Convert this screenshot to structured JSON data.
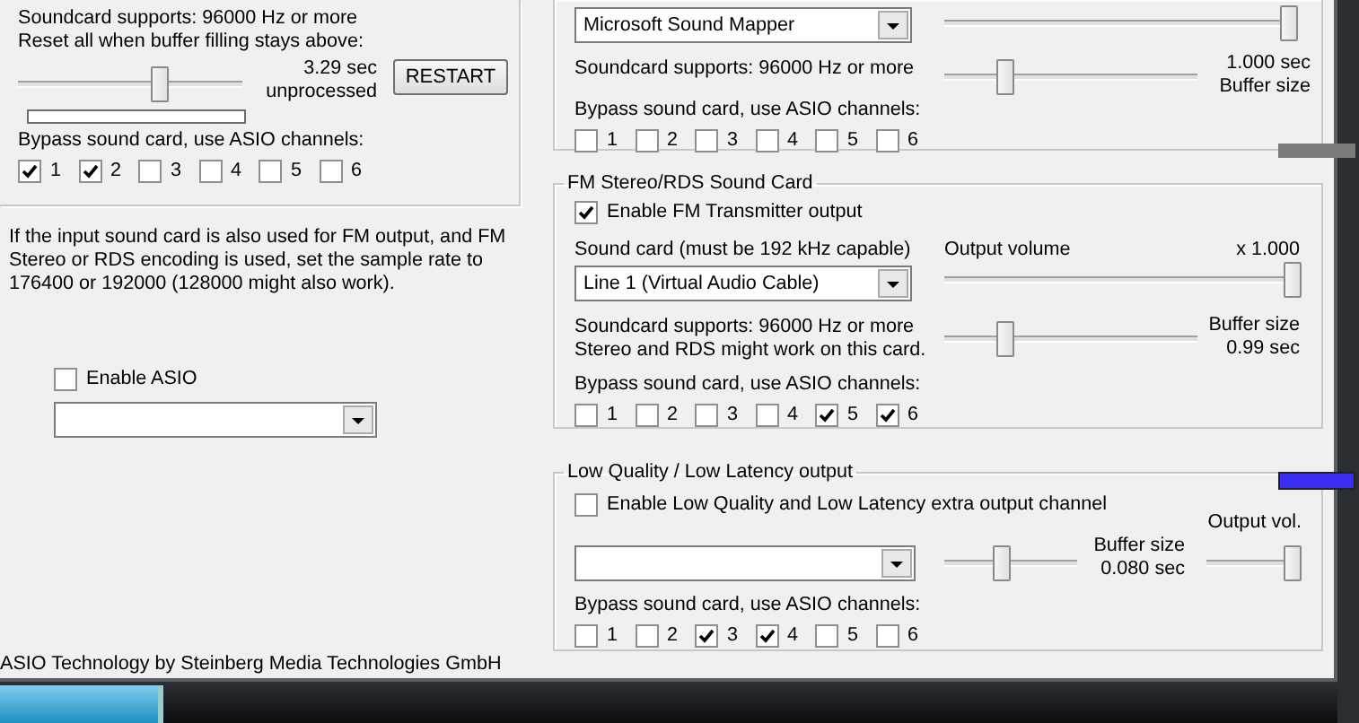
{
  "left_group": {
    "soundcard_supports": "Soundcard supports:  96000 Hz or more",
    "reset_label": "Reset all when buffer filling stays above:",
    "reset_slider": {
      "level": 0.64
    },
    "readout": [
      "3.29 sec",
      "unprocessed"
    ],
    "restart_button": "RESTART",
    "bypass_label": "Bypass sound card, use ASIO channels:",
    "channels": [
      {
        "label": "1",
        "checked": true
      },
      {
        "label": "2",
        "checked": true
      },
      {
        "label": "3",
        "checked": false
      },
      {
        "label": "4",
        "checked": false
      },
      {
        "label": "5",
        "checked": false
      },
      {
        "label": "6",
        "checked": false
      }
    ]
  },
  "sample_rate_note": "If the input sound card is also used for FM output, and FM Stereo or RDS encoding is used, set the sample rate to 176400 or 192000 (128000 might also work).",
  "asio": {
    "label": "Enable ASIO",
    "checked": false
  },
  "footer": "ASIO Technology by Steinberg Media Technologies GmbH",
  "output_group": {
    "sound_card": "Microsoft Sound Mapper",
    "volume_slider": {
      "level": 1
    },
    "soundcard_supports": "Soundcard supports:  96000 Hz or more",
    "buffer_slider": {
      "level": 0.22
    },
    "buffer_readout": [
      "1.000 sec",
      "Buffer size"
    ],
    "bypass_label": "Bypass sound card, use ASIO channels:",
    "channels": [
      {
        "label": "1",
        "checked": false
      },
      {
        "label": "2",
        "checked": false
      },
      {
        "label": "3",
        "checked": false
      },
      {
        "label": "4",
        "checked": false
      },
      {
        "label": "5",
        "checked": false
      },
      {
        "label": "6",
        "checked": false
      }
    ]
  },
  "fm_group": {
    "title": "FM Stereo/RDS Sound Card",
    "enable": {
      "label": "Enable FM Transmitter output",
      "checked": true
    },
    "sound_card_label": "Sound card (must be 192 kHz capable)",
    "output_volume_label": "Output volume",
    "output_volume_value": "x 1.000",
    "sound_card": "Line 1 (Virtual Audio Cable)",
    "volume_slider": {
      "level": 1
    },
    "soundcard_supports": "Soundcard supports:  96000 Hz or more",
    "note": "Stereo and RDS might work on this card.",
    "buffer_slider": {
      "level": 0.22
    },
    "buffer_readout": [
      "Buffer size",
      "0.99 sec"
    ],
    "bypass_label": "Bypass sound card, use ASIO channels:",
    "channels": [
      {
        "label": "1",
        "checked": false
      },
      {
        "label": "2",
        "checked": false
      },
      {
        "label": "3",
        "checked": false
      },
      {
        "label": "4",
        "checked": false
      },
      {
        "label": "5",
        "checked": true
      },
      {
        "label": "6",
        "checked": true
      }
    ]
  },
  "low_latency_group": {
    "title": "Low Quality / Low Latency output",
    "enable": {
      "label": "Enable Low Quality and Low Latency extra output channel",
      "checked": false
    },
    "buffer_slider": {
      "level": 0.42
    },
    "buffer_readout": [
      "Buffer size",
      "0.080 sec"
    ],
    "output_vol_label": "Output vol.",
    "volume_slider": {
      "level": 1
    },
    "bypass_label": "Bypass sound card, use ASIO channels:",
    "channels": [
      {
        "label": "1",
        "checked": false
      },
      {
        "label": "2",
        "checked": false
      },
      {
        "label": "3",
        "checked": true
      },
      {
        "label": "4",
        "checked": true
      },
      {
        "label": "5",
        "checked": false
      },
      {
        "label": "6",
        "checked": false
      }
    ]
  }
}
